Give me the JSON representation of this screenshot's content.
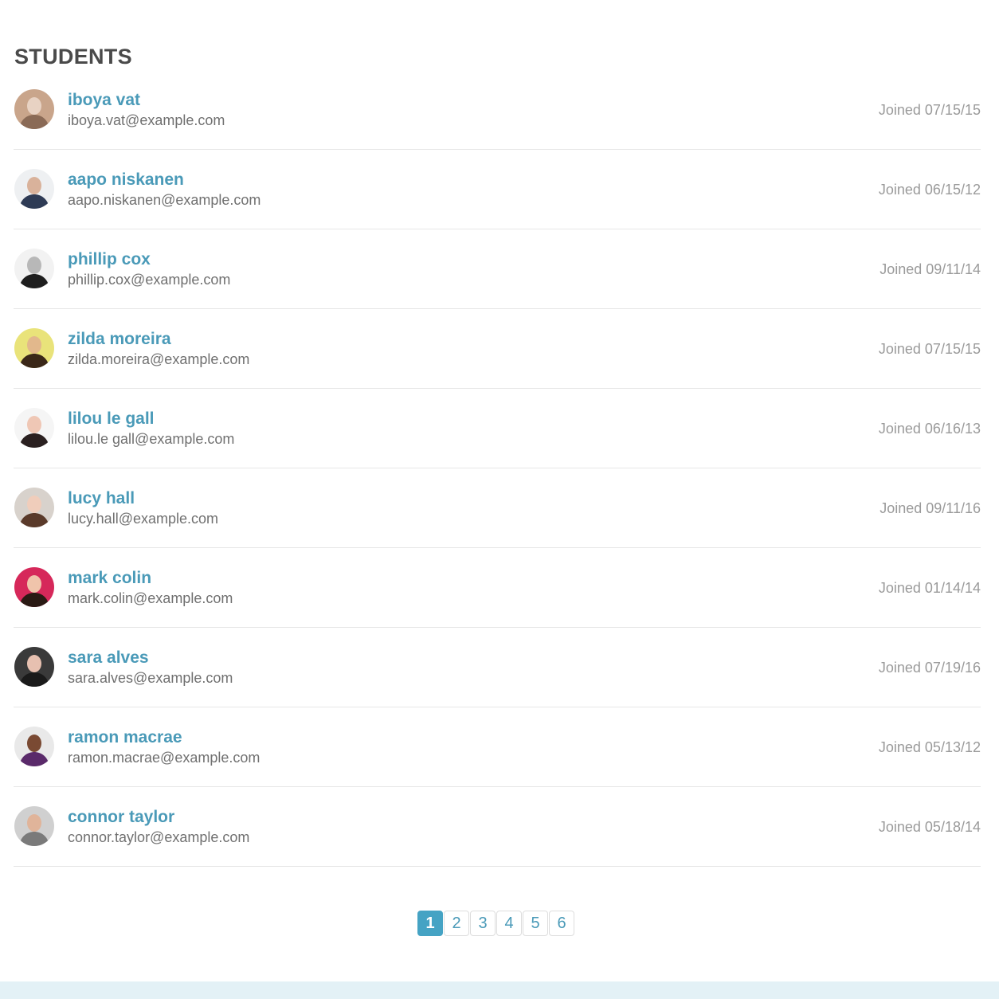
{
  "section": {
    "title": "STUDENTS"
  },
  "joined_label": "Joined",
  "students": [
    {
      "name": "iboya vat",
      "email": "iboya.vat@example.com",
      "joined": "07/15/15",
      "avatar_colors": [
        "#c9a58b",
        "#e8d2c3",
        "#8a6a56"
      ]
    },
    {
      "name": "aapo niskanen",
      "email": "aapo.niskanen@example.com",
      "joined": "06/15/12",
      "avatar_colors": [
        "#eef0f2",
        "#d9b29b",
        "#2e3b55"
      ]
    },
    {
      "name": "phillip cox",
      "email": "phillip.cox@example.com",
      "joined": "09/11/14",
      "avatar_colors": [
        "#f2f2f2",
        "#b8b8b8",
        "#1e1e1e"
      ]
    },
    {
      "name": "zilda moreira",
      "email": "zilda.moreira@example.com",
      "joined": "07/15/15",
      "avatar_colors": [
        "#e9e37a",
        "#e2b88c",
        "#3a2718"
      ]
    },
    {
      "name": "lilou le gall",
      "email": "lilou.le gall@example.com",
      "joined": "06/16/13",
      "avatar_colors": [
        "#f5f5f5",
        "#efc7b5",
        "#2a2020"
      ]
    },
    {
      "name": "lucy hall",
      "email": "lucy.hall@example.com",
      "joined": "09/11/16",
      "avatar_colors": [
        "#d8d2cc",
        "#f0cdbb",
        "#5a3a2a"
      ]
    },
    {
      "name": "mark colin",
      "email": "mark.colin@example.com",
      "joined": "01/14/14",
      "avatar_colors": [
        "#d6285a",
        "#f0c4ab",
        "#2a1a14"
      ]
    },
    {
      "name": "sara alves",
      "email": "sara.alves@example.com",
      "joined": "07/19/16",
      "avatar_colors": [
        "#3a3a3a",
        "#e7c0b0",
        "#1a1a1a"
      ]
    },
    {
      "name": "ramon macrae",
      "email": "ramon.macrae@example.com",
      "joined": "05/13/12",
      "avatar_colors": [
        "#e9e9e9",
        "#7a4a33",
        "#5a2a6a"
      ]
    },
    {
      "name": "connor taylor",
      "email": "connor.taylor@example.com",
      "joined": "05/18/14",
      "avatar_colors": [
        "#d0d0d0",
        "#e0b49a",
        "#7a7a7a"
      ]
    }
  ],
  "pagination": {
    "pages": [
      "1",
      "2",
      "3",
      "4",
      "5",
      "6"
    ],
    "current": "1"
  },
  "colors": {
    "accent": "#45a3c4",
    "link": "#4a9ab8",
    "footer": "#e3f1f6"
  }
}
